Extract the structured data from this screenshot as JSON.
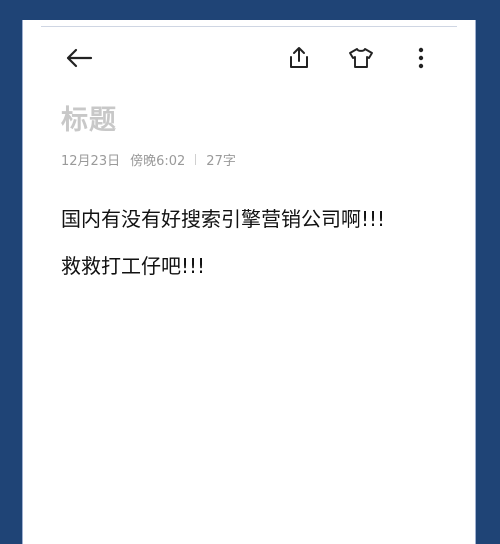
{
  "toolbar": {
    "back_icon": "arrow-left-icon",
    "share_icon": "share-icon",
    "theme_icon": "tshirt-icon",
    "more_icon": "more-vertical-icon"
  },
  "note": {
    "title_placeholder": "标题",
    "date": "12月23日",
    "time": "傍晚6:02",
    "char_count": "27字",
    "paragraphs": [
      "国内有没有好搜索引擎营销公司啊!!!",
      "救救打工仔吧!!!"
    ]
  },
  "colors": {
    "frame": "#1f4476",
    "title_placeholder": "#c8c8c8",
    "meta_text": "#9a9a9a",
    "body_text": "#111111"
  }
}
